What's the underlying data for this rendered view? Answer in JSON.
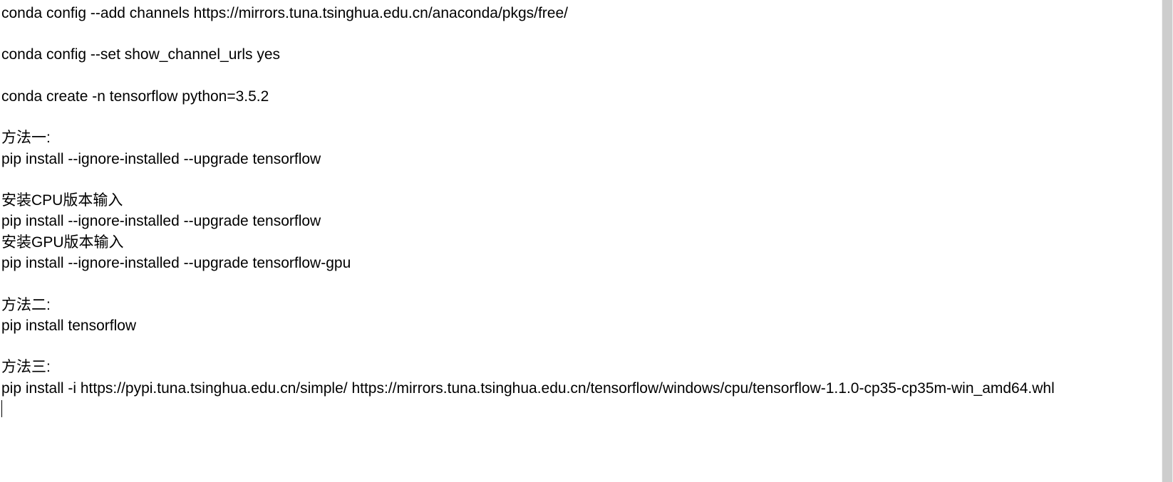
{
  "lines": [
    "conda config --add channels https://mirrors.tuna.tsinghua.edu.cn/anaconda/pkgs/free/",
    "",
    "conda config --set show_channel_urls yes",
    "",
    "conda create -n tensorflow python=3.5.2",
    "",
    "方法一:",
    "pip install --ignore-installed --upgrade tensorflow",
    "",
    "安装CPU版本输入",
    "pip install --ignore-installed --upgrade tensorflow",
    "安装GPU版本输入",
    "pip install --ignore-installed --upgrade tensorflow-gpu",
    "",
    "方法二:",
    "pip install tensorflow",
    "",
    "方法三:",
    "pip install -i https://pypi.tuna.tsinghua.edu.cn/simple/ https://mirrors.tuna.tsinghua.edu.cn/tensorflow/windows/cpu/tensorflow-1.1.0-cp35-cp35m-win_amd64.whl"
  ]
}
